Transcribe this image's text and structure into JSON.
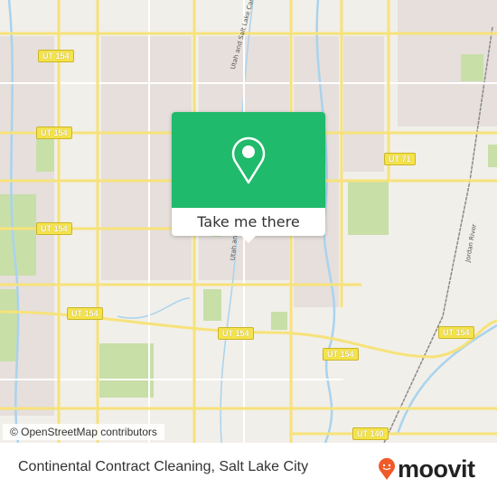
{
  "map": {
    "road_shields": [
      "UT 154",
      "UT 154",
      "UT 154",
      "UT 154",
      "UT 154",
      "UT 154",
      "UT 154",
      "UT 71",
      "UT 140"
    ],
    "road_labels": [
      "Utah and Salt Lake Canal",
      "Utah and S",
      "Jordan River"
    ],
    "attribution": "© OpenStreetMap contributors",
    "colors": {
      "major_road": "#f7e27a",
      "water": "#a9d3ee",
      "park": "#c8dfa8",
      "urban": "#e8e1de"
    }
  },
  "popup": {
    "icon": "map-pin-icon",
    "button_label": "Take me there",
    "color": "#1fba6b"
  },
  "footer": {
    "place_title": "Continental Contract Cleaning, Salt Lake City",
    "brand": "moovit",
    "brand_color": "#f05a28"
  }
}
